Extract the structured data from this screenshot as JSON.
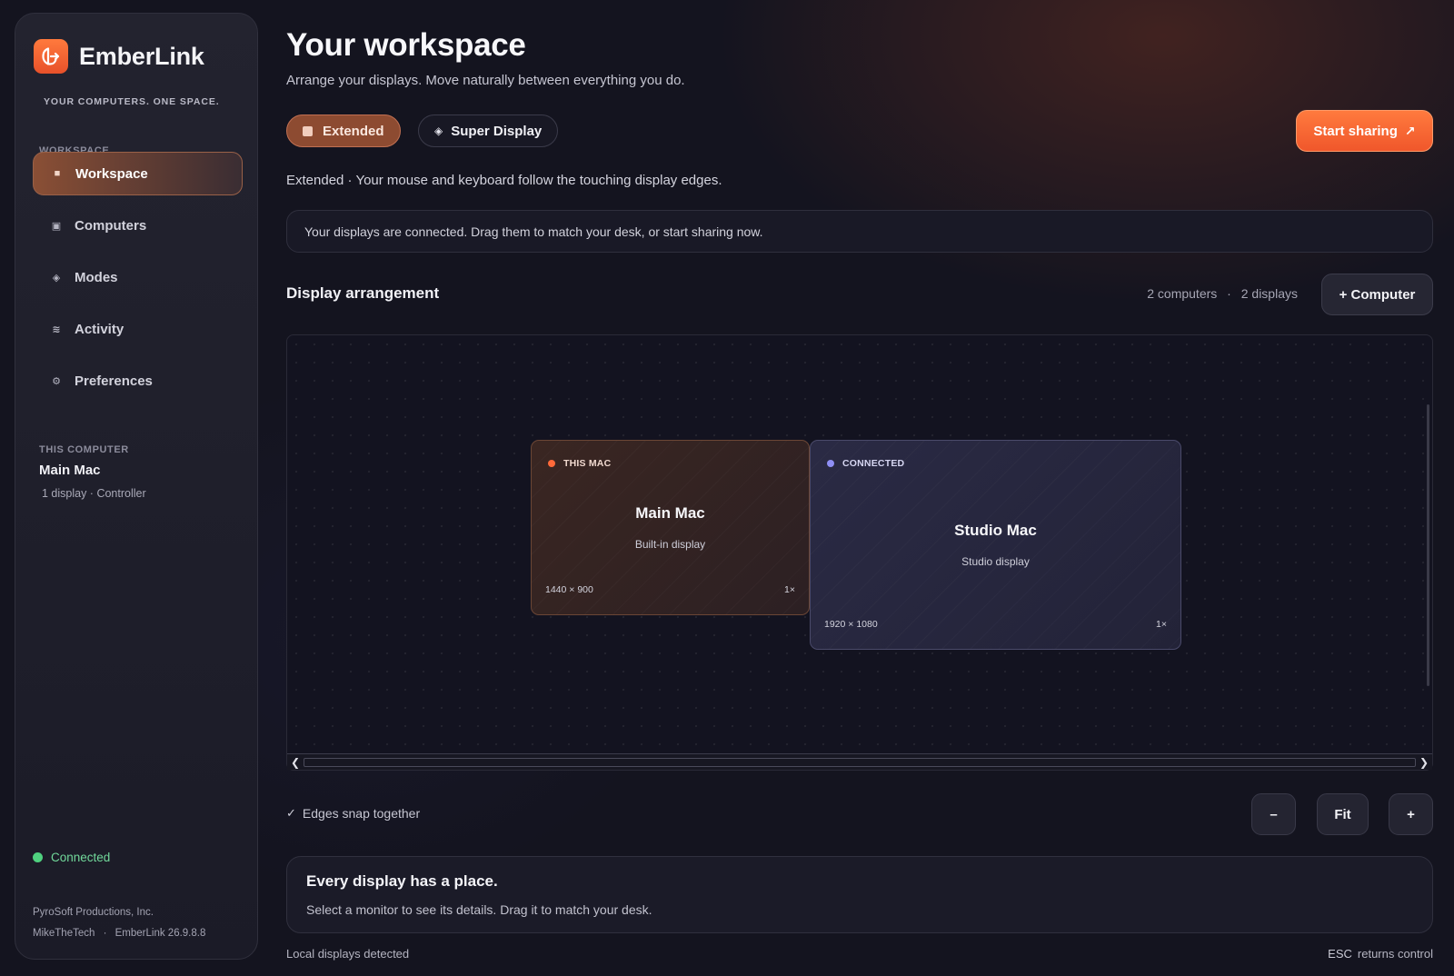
{
  "brand": {
    "name": "EmberLink",
    "tagline": "YOUR COMPUTERS. ONE SPACE."
  },
  "sidebar": {
    "section_label": "WORKSPACE",
    "items": [
      {
        "label": "Workspace",
        "icon": "square-icon",
        "glyph": "■",
        "active": true
      },
      {
        "label": "Computers",
        "icon": "monitor-icon",
        "glyph": "▣",
        "active": false
      },
      {
        "label": "Modes",
        "icon": "diamond-icon",
        "glyph": "◈",
        "active": false
      },
      {
        "label": "Activity",
        "icon": "activity-icon",
        "glyph": "≋",
        "active": false
      },
      {
        "label": "Preferences",
        "icon": "gear-icon",
        "glyph": "⚙",
        "active": false
      }
    ],
    "this_computer": {
      "label": "THIS COMPUTER",
      "name": "Main Mac",
      "meta": "1 display · Controller"
    },
    "status": {
      "label": "Connected",
      "color": "#4fd17f"
    },
    "footer": {
      "company": "PyroSoft Productions, Inc.",
      "user": "MikeTheTech",
      "separator": "·",
      "version": "EmberLink 26.9.8.8"
    }
  },
  "header": {
    "title": "Your workspace",
    "subtitle": "Arrange your displays. Move naturally between everything you do."
  },
  "modes": {
    "extended_label": "Extended",
    "super_display_label": "Super Display",
    "description": "Extended · Your mouse and keyboard follow the touching display edges."
  },
  "actions": {
    "start_sharing": "Start sharing",
    "start_icon": "↗"
  },
  "banner": {
    "text": "Your displays are connected. Drag them to match your desk, or start sharing now."
  },
  "arrangement": {
    "title": "Display arrangement",
    "computers_count": "2 computers",
    "count_separator": "·",
    "displays_count": "2 displays",
    "add_computer": "+ Computer",
    "displays": [
      {
        "tag": "THIS MAC",
        "name": "Main Mac",
        "sub": "Built-in display",
        "resolution": "1440 × 900",
        "scale": "1×"
      },
      {
        "tag": "CONNECTED",
        "name": "Studio Mac",
        "sub": "Studio display",
        "resolution": "1920 × 1080",
        "scale": "1×"
      }
    ],
    "snap": {
      "check": "✓",
      "label": "Edges snap together"
    },
    "zoom": {
      "out": "–",
      "fit": "Fit",
      "in": "+"
    }
  },
  "info": {
    "title": "Every display has a place.",
    "text": "Select a monitor to see its details. Drag it to match your desk."
  },
  "footer": {
    "left": "Local displays detected",
    "key": "ESC",
    "right": "returns control"
  },
  "colors": {
    "accent": "#f0572b",
    "accent_light": "#ff7a3e",
    "connected": "#4fd17f",
    "studio_dot": "#8f8ff5"
  }
}
